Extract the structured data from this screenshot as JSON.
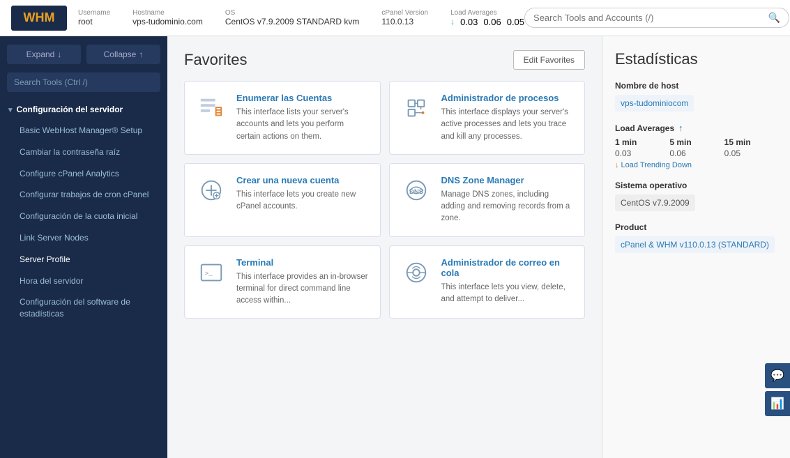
{
  "topbar": {
    "logo": "WHM",
    "meta": {
      "username_label": "Username",
      "username_value": "root",
      "hostname_label": "Hostname",
      "hostname_value": "vps-tudominio.com",
      "os_label": "OS",
      "os_value": "CentOS v7.9.2009 STANDARD kvm",
      "cpanel_label": "cPanel Version",
      "cpanel_value": "110.0.13",
      "load_label": "Load Averages",
      "load_1": "0.03",
      "load_5": "0.06",
      "load_15": "0.05"
    },
    "search_placeholder": "Search Tools and Accounts (/)",
    "search_label": "Search Tools and Accounts"
  },
  "sidebar": {
    "expand_label": "Expand",
    "collapse_label": "Collapse",
    "search_placeholder": "Search Tools (Ctrl /)",
    "section": "Configuración del servidor",
    "items": [
      "Basic WebHost Manager® Setup",
      "Cambiar la contraseña raíz",
      "Configure cPanel Analytics",
      "Configurar trabajos de cron cPanel",
      "Configuración de la cuota inicial",
      "Link Server Nodes",
      "Server Profile",
      "Hora del servidor",
      "Configuración del software de estadísticas"
    ]
  },
  "favorites": {
    "title": "Favorites",
    "edit_btn": "Edit Favorites",
    "cards": [
      {
        "title": "Enumerar las Cuentas",
        "desc": "This interface lists your server's accounts and lets you perform certain actions on them."
      },
      {
        "title": "Administrador de procesos",
        "desc": "This interface displays your server's active processes and lets you trace and kill any processes."
      },
      {
        "title": "Crear una nueva cuenta",
        "desc": "This interface lets you create new cPanel accounts."
      },
      {
        "title": "DNS Zone Manager",
        "desc": "Manage DNS zones, including adding and removing records from a zone."
      },
      {
        "title": "Terminal",
        "desc": "This interface provides an in-browser terminal for direct command line access within..."
      },
      {
        "title": "Administrador de correo en cola",
        "desc": "This interface lets you view, delete, and attempt to deliver..."
      }
    ]
  },
  "stats": {
    "title": "Estadísticas",
    "hostname_label": "Nombre de host",
    "hostname_value": "vps-tudominiocom",
    "load_avg_label": "Load Averages",
    "load_1_header": "1 min",
    "load_5_header": "5 min",
    "load_15_header": "15 min",
    "load_1_val": "0.03",
    "load_5_val": "0.06",
    "load_15_val": "0.05",
    "trending_label": "Load Trending Down",
    "os_label": "Sistema operativo",
    "os_value": "CentOS v7.9.2009",
    "product_label": "Product",
    "product_value": "cPanel & WHM v110.0.13 (STANDARD)"
  },
  "float_btns": {
    "chat_icon": "💬",
    "chart_icon": "📊"
  }
}
